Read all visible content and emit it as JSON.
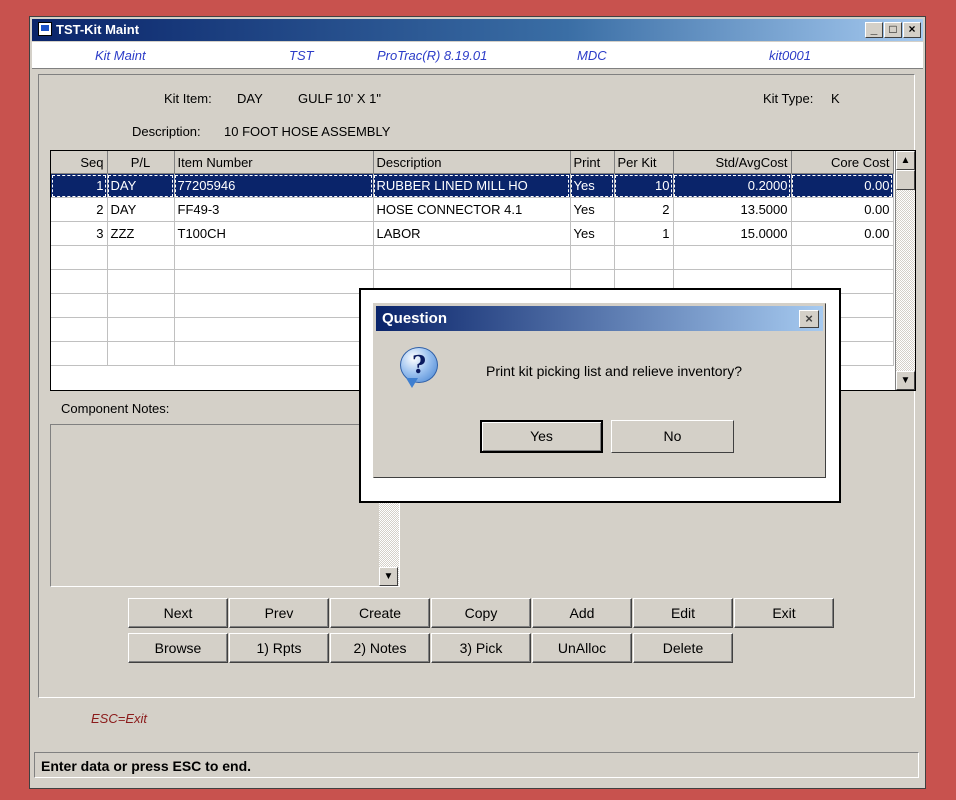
{
  "window": {
    "title": "TST-Kit Maint"
  },
  "infobar": {
    "screen": "Kit Maint",
    "company": "TST",
    "product": "ProTrac(R) 8.19.01",
    "location": "MDC",
    "program": "kit0001"
  },
  "header": {
    "kit_item_label": "Kit Item:",
    "kit_item_pl": "DAY",
    "kit_item_number": "GULF 10' X 1\"",
    "kit_type_label": "Kit Type:",
    "kit_type_value": "K",
    "description_label": "Description:",
    "description_value": "10 FOOT HOSE ASSEMBLY"
  },
  "grid": {
    "columns": [
      "Seq",
      "P/L",
      "Item Number",
      "Description",
      "Print",
      "Per Kit",
      "Std/AvgCost",
      "Core Cost"
    ],
    "rows": [
      [
        "1",
        "DAY",
        "77205946",
        "RUBBER LINED MILL HO",
        "Yes",
        "10",
        "0.2000",
        "0.00"
      ],
      [
        "2",
        "DAY",
        "FF49-3",
        "HOSE CONNECTOR 4.1",
        "Yes",
        "2",
        "13.5000",
        "0.00"
      ],
      [
        "3",
        "ZZZ",
        "T100CH",
        "LABOR",
        "Yes",
        "1",
        "15.0000",
        "0.00"
      ]
    ]
  },
  "notes": {
    "label": "Component Notes:"
  },
  "buttons": {
    "next": "Next",
    "prev": "Prev",
    "create": "Create",
    "copy": "Copy",
    "add": "Add",
    "edit": "Edit",
    "exit": "Exit",
    "browse": "Browse",
    "rpts": "1) Rpts",
    "notes": "2) Notes",
    "pick": "3) Pick",
    "unalloc": "UnAlloc",
    "delete": "Delete"
  },
  "footer": {
    "esc_hint": "ESC=Exit",
    "status": "Enter data or press ESC to end."
  },
  "dialog": {
    "title": "Question",
    "message": "Print kit picking list and relieve inventory?",
    "yes": "Yes",
    "no": "No"
  }
}
